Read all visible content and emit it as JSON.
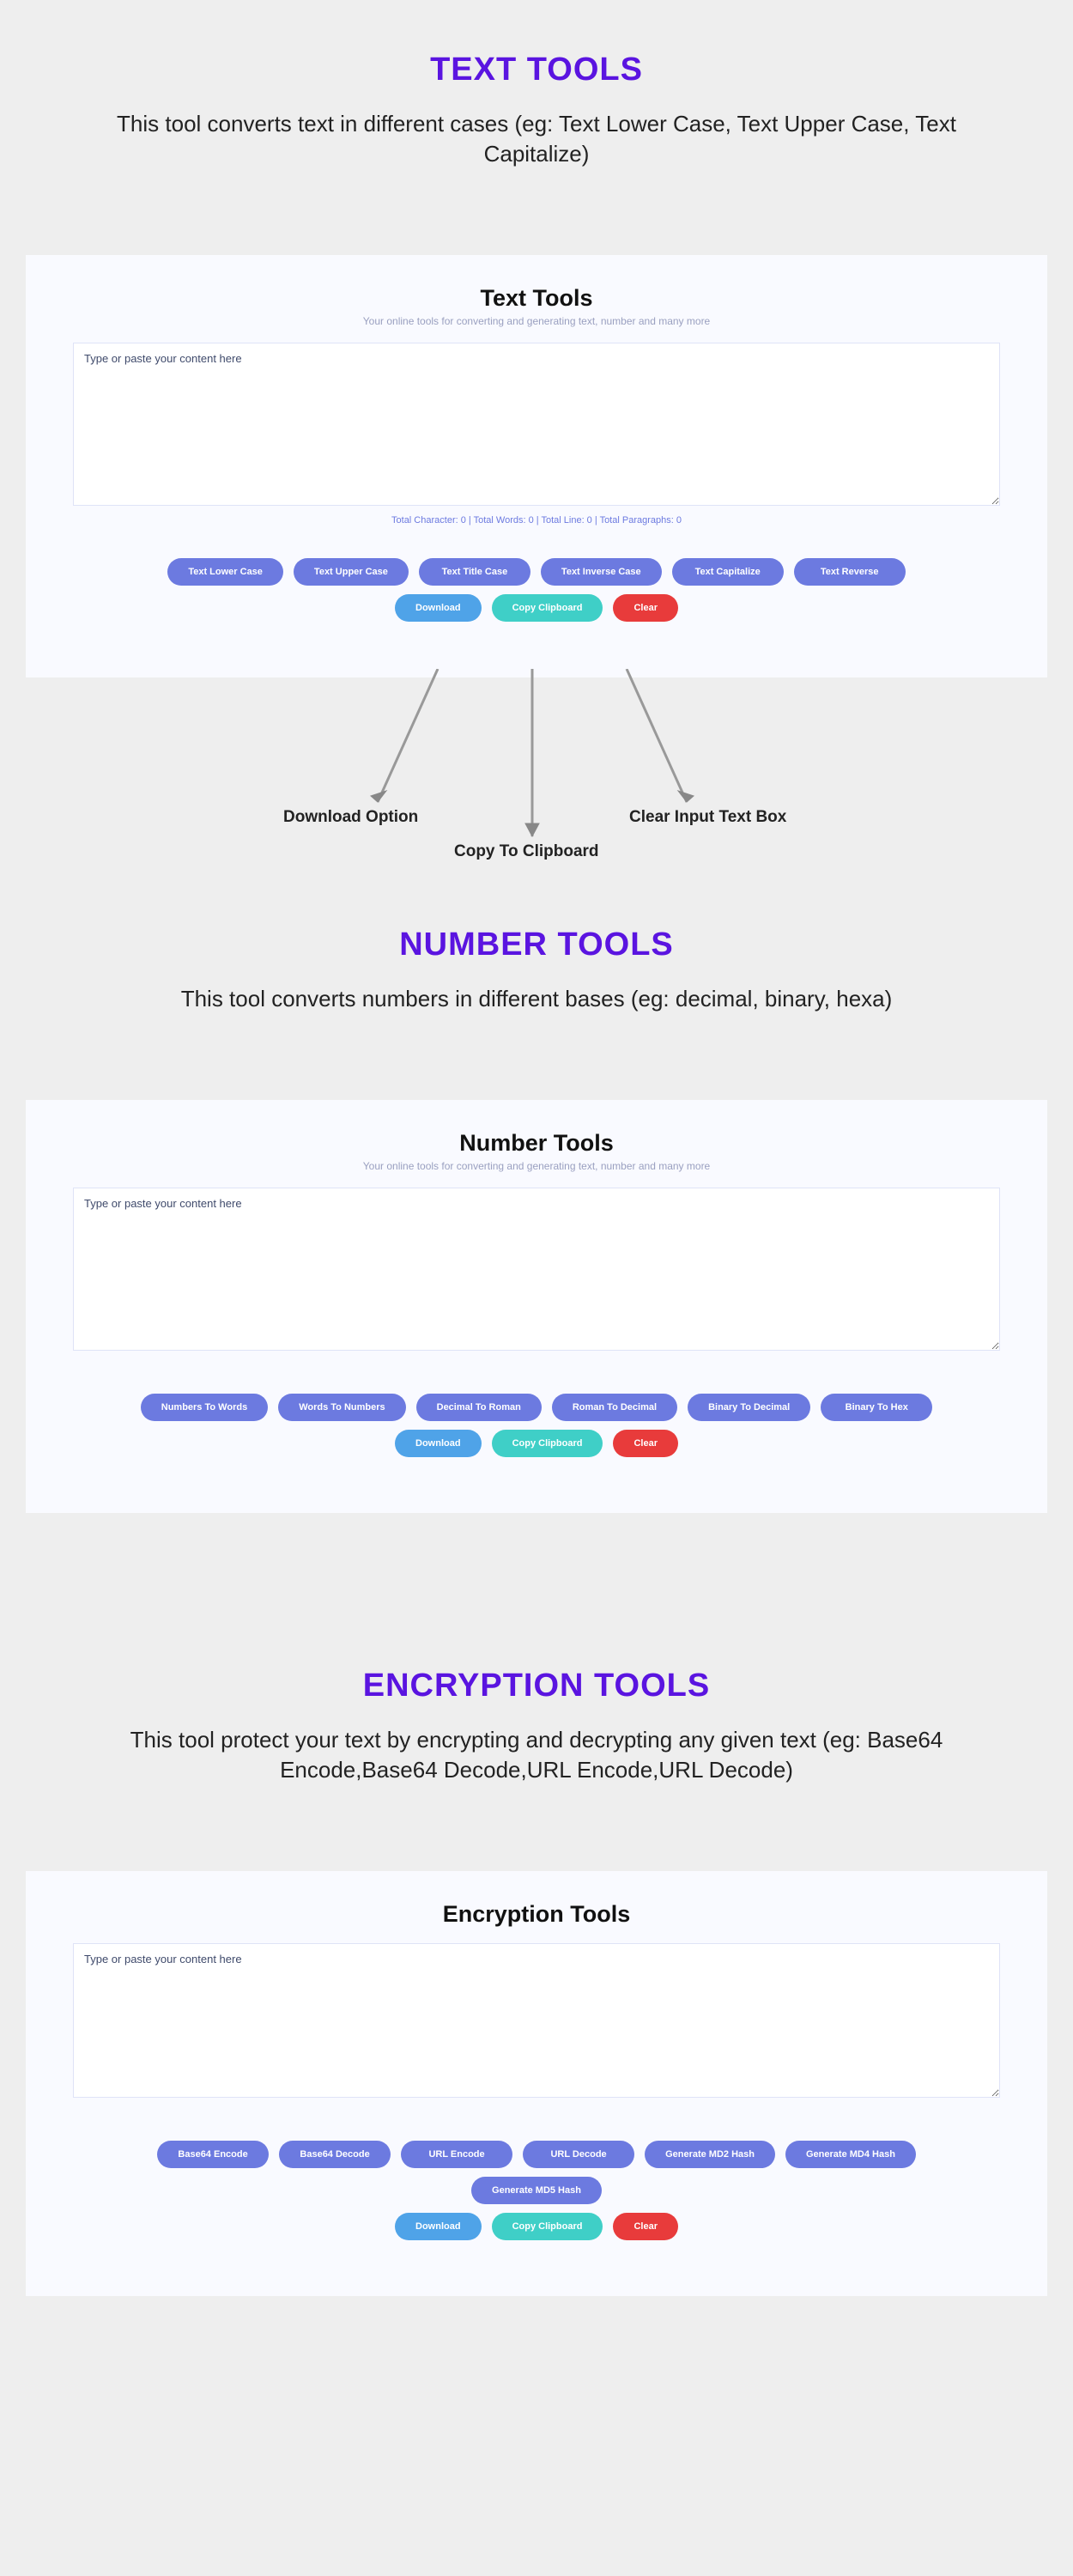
{
  "textTools": {
    "heading": "TEXT TOOLS",
    "description": "This tool converts text in different cases (eg: Text Lower Case, Text Upper Case, Text Capitalize)",
    "panelTitle": "Text Tools",
    "panelSubtitle": "Your online tools for converting and generating text, number and many more",
    "placeholder": "Type or paste your content here",
    "counter": "Total Character: 0 | Total Words: 0 | Total Line: 0 | Total Paragraphs: 0",
    "buttons": [
      "Text Lower Case",
      "Text Upper Case",
      "Text Title Case",
      "Text Inverse Case",
      "Text Capitalize",
      "Text Reverse"
    ],
    "actions": {
      "download": "Download",
      "copy": "Copy Clipboard",
      "clear": "Clear"
    },
    "annotations": {
      "download": "Download Option",
      "copy": "Copy To Clipboard",
      "clear": "Clear Input Text Box"
    }
  },
  "numberTools": {
    "heading": "NUMBER TOOLS",
    "description": "This tool converts numbers in different bases (eg: decimal, binary, hexa)",
    "panelTitle": "Number Tools",
    "panelSubtitle": "Your online tools for converting and generating text, number and many more",
    "placeholder": "Type or paste your content here",
    "buttons": [
      "Numbers To Words",
      "Words To Numbers",
      "Decimal To Roman",
      "Roman To Decimal",
      "Binary To Decimal",
      "Binary To Hex"
    ],
    "actions": {
      "download": "Download",
      "copy": "Copy Clipboard",
      "clear": "Clear"
    }
  },
  "encryptionTools": {
    "heading": "ENCRYPTION TOOLS",
    "description": "This tool protect your text by encrypting and decrypting any given text (eg: Base64 Encode,Base64 Decode,URL Encode,URL Decode)",
    "panelTitle": "Encryption Tools",
    "placeholder": "Type or paste your content here",
    "buttons": [
      "Base64 Encode",
      "Base64 Decode",
      "URL Encode",
      "URL Decode",
      "Generate MD2 Hash",
      "Generate MD4 Hash",
      "Generate MD5 Hash"
    ],
    "actions": {
      "download": "Download",
      "copy": "Copy Clipboard",
      "clear": "Clear"
    }
  }
}
